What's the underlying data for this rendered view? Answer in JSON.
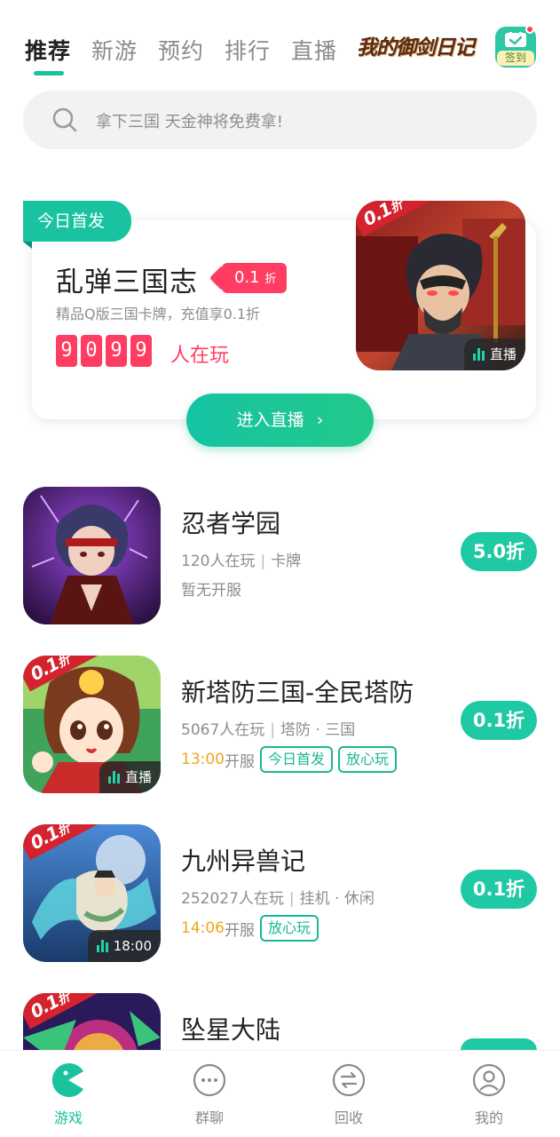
{
  "top_tabs": {
    "items": [
      "推荐",
      "新游",
      "预约",
      "排行",
      "直播"
    ],
    "active": "推荐",
    "banner_text": "我的御剑日记",
    "signin_label": "签到"
  },
  "search": {
    "placeholder": "拿下三国 天金神将免费拿!"
  },
  "featured": {
    "tag": "今日首发",
    "title": "乱弹三国志",
    "discount_value": "0.1",
    "discount_unit": "折",
    "subtitle": "精品Q版三国卡牌，充值享0.1折",
    "player_digits": [
      "9",
      "0",
      "9",
      "9"
    ],
    "players_suffix": "人在玩",
    "art_ribbon_value": "0.1",
    "art_ribbon_unit": "折",
    "art_live_label": "直播",
    "enter_button": "进入直播"
  },
  "games": [
    {
      "name": "忍者学园",
      "players": "120人在玩",
      "tags": "卡牌",
      "server_time": "",
      "server_text": "暂无开服",
      "pills": [],
      "discount": "5.0折",
      "ribbon": false,
      "badge": ""
    },
    {
      "name": "新塔防三国-全民塔防",
      "players": "5067人在玩",
      "tags": "塔防 · 三国",
      "server_time": "13:00",
      "server_text": "开服",
      "pills": [
        "今日首发",
        "放心玩"
      ],
      "discount": "0.1折",
      "ribbon": true,
      "ribbon_value": "0.1",
      "ribbon_unit": "折",
      "badge": "直播"
    },
    {
      "name": "九州异兽记",
      "players": "252027人在玩",
      "tags": "挂机 · 休闲",
      "server_time": "14:06",
      "server_text": "开服",
      "pills": [
        "放心玩"
      ],
      "discount": "0.1折",
      "ribbon": true,
      "ribbon_value": "0.1",
      "ribbon_unit": "折",
      "badge": "18:00"
    },
    {
      "name": "坠星大陆",
      "ribbon": true,
      "ribbon_value": "0.1",
      "ribbon_unit": "折"
    }
  ],
  "bottom_nav": {
    "items": [
      "游戏",
      "群聊",
      "回收",
      "我的"
    ],
    "active": "游戏"
  },
  "colors": {
    "accent": "#1bc39c",
    "discount_red": "#ff3d62",
    "server_time": "#f2a51a"
  }
}
